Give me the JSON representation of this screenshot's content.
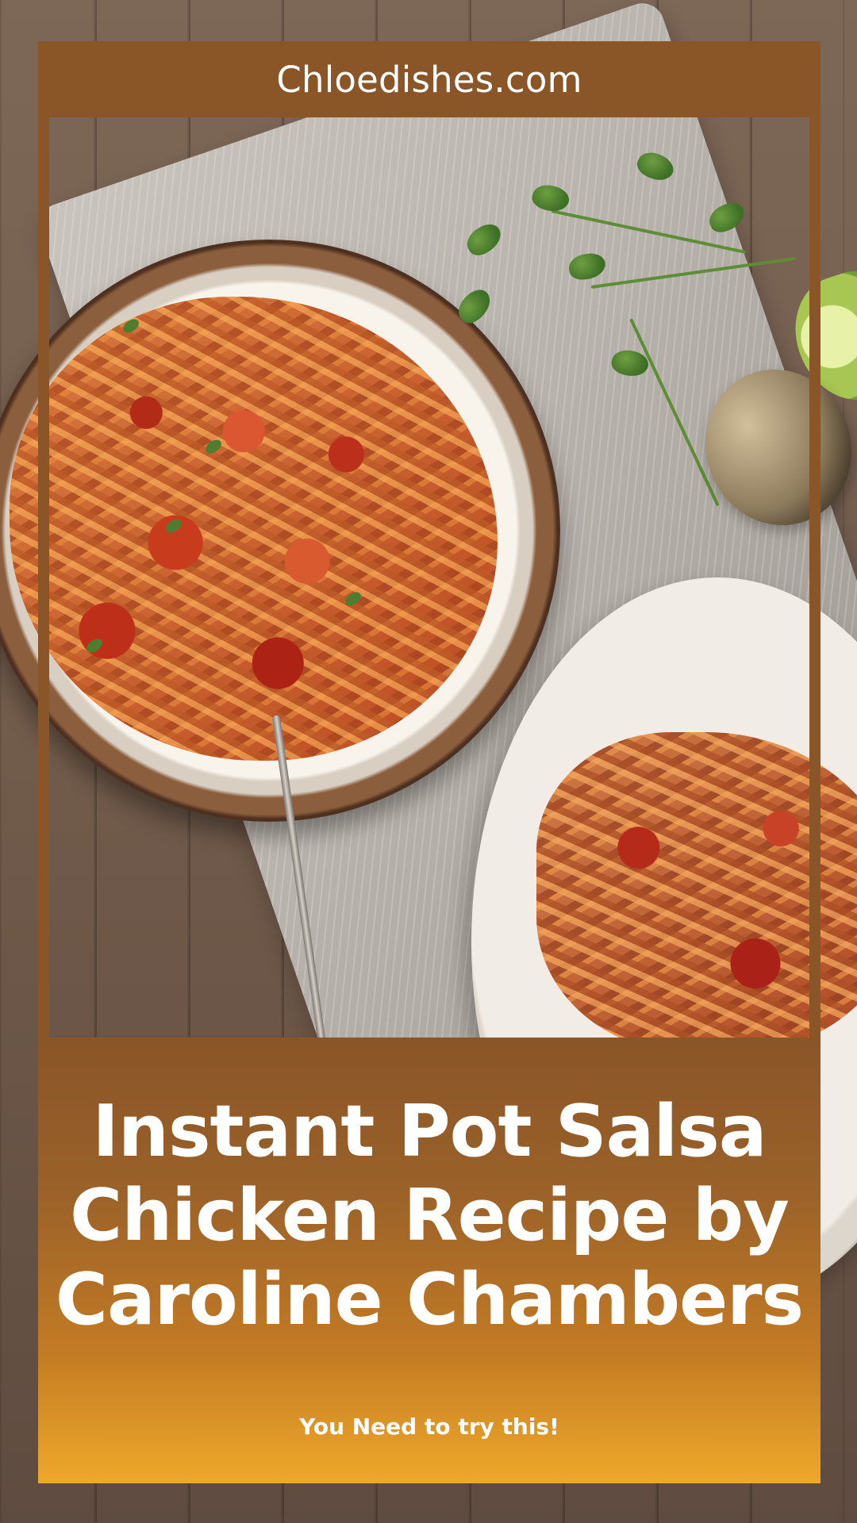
{
  "site": {
    "name": "Chloedishes.com"
  },
  "recipe": {
    "title_line_1": "Instant Pot Salsa",
    "title_line_2": "Chicken Recipe by",
    "title_line_3": "Caroline Chambers",
    "tagline": "You Need to try this!"
  },
  "colors": {
    "header_brown": "#8a5527",
    "gradient_orange": "#efa82a",
    "text": "#ffffff"
  },
  "visual": {
    "food_image": "salsa-chicken-photo"
  }
}
